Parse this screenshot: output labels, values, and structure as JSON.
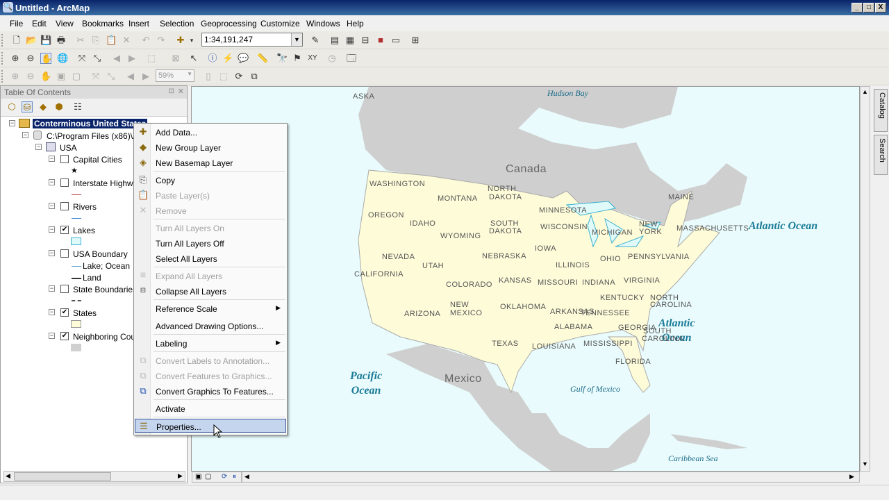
{
  "window": {
    "title": "Untitled - ArcMap",
    "min": "_",
    "max": "□",
    "close": "X"
  },
  "menubar": [
    "File",
    "Edit",
    "View",
    "Bookmarks",
    "Insert",
    "Selection",
    "Geoprocessing",
    "Customize",
    "Windows",
    "Help"
  ],
  "toolbar": {
    "scale": "1:34,191,247",
    "zoom_percent": "59%"
  },
  "toc": {
    "title": "Table Of Contents",
    "dataframe": "Conterminous United States",
    "database": "C:\\Program Files (x86)\\Ar",
    "group": "USA",
    "layers": [
      {
        "name": "Capital Cities",
        "checked": false
      },
      {
        "name": "Interstate Highwa",
        "checked": false
      },
      {
        "name": "Rivers",
        "checked": false
      },
      {
        "name": "Lakes",
        "checked": true
      },
      {
        "name": "USA Boundary",
        "checked": false
      },
      {
        "name": "State Boundaries",
        "checked": false
      },
      {
        "name": "States",
        "checked": true
      },
      {
        "name": "Neighboring Count",
        "checked": true
      }
    ],
    "boundary_legend": [
      "Lake; Ocean",
      "Land"
    ]
  },
  "context_menu": {
    "items": [
      {
        "label": "Add Data...",
        "enabled": true
      },
      {
        "label": "New Group Layer",
        "enabled": true
      },
      {
        "label": "New Basemap Layer",
        "enabled": true
      },
      {
        "label": "Copy",
        "enabled": true
      },
      {
        "label": "Paste Layer(s)",
        "enabled": false
      },
      {
        "label": "Remove",
        "enabled": false
      },
      {
        "label": "Turn All Layers On",
        "enabled": false
      },
      {
        "label": "Turn All Layers Off",
        "enabled": true
      },
      {
        "label": "Select All Layers",
        "enabled": true
      },
      {
        "label": "Expand All Layers",
        "enabled": false
      },
      {
        "label": "Collapse All Layers",
        "enabled": true
      },
      {
        "label": "Reference Scale",
        "enabled": true
      },
      {
        "label": "Advanced Drawing Options...",
        "enabled": true
      },
      {
        "label": "Labeling",
        "enabled": true
      },
      {
        "label": "Convert Labels to Annotation...",
        "enabled": false
      },
      {
        "label": "Convert Features to Graphics...",
        "enabled": false
      },
      {
        "label": "Convert Graphics To Features...",
        "enabled": true
      },
      {
        "label": "Activate",
        "enabled": true
      },
      {
        "label": "Properties...",
        "enabled": true,
        "highlighted": true
      }
    ]
  },
  "map": {
    "countries": [
      "Canada",
      "Mexico"
    ],
    "oceans": {
      "atlantic_ne": "Atlantic Ocean",
      "atlantic_se_1": "Atlantic",
      "atlantic_se_2": "Ocean",
      "pacific_1": "Pacific",
      "pacific_2": "Ocean"
    },
    "waters": [
      "Hudson Bay",
      "Gulf of Mexico",
      "Caribbean Sea"
    ],
    "clipped": "ASKA",
    "states": [
      "WASHINGTON",
      "OREGON",
      "CALIFORNIA",
      "IDAHO",
      "MONTANA",
      "WYOMING",
      "NEVADA",
      "UTAH",
      "ARIZONA",
      "COLORADO",
      "NEW",
      "MEXICO",
      "NORTH",
      "DAKOTA",
      "SOUTH",
      "DAKOTA",
      "NEBRASKA",
      "KANSAS",
      "OKLAHOMA",
      "TEXAS",
      "MINNESOTA",
      "IOWA",
      "MISSOURI",
      "ARKANSAS",
      "LOUISIANA",
      "WISCONSIN",
      "ILLINOIS",
      "MICHIGAN",
      "INDIANA",
      "OHIO",
      "KENTUCKY",
      "TENNESSEE",
      "MISSISSIPPI",
      "ALABAMA",
      "GEORGIA",
      "FLORIDA",
      "SOUTH",
      "CAROLINA",
      "NORTH",
      "CAROLINA",
      "VIRGINIA",
      "PENNSYLVANIA",
      "NEW",
      "YORK",
      "MASSACHUSETTS",
      "MAINE"
    ]
  },
  "side_tabs": [
    "Catalog",
    "Search"
  ]
}
